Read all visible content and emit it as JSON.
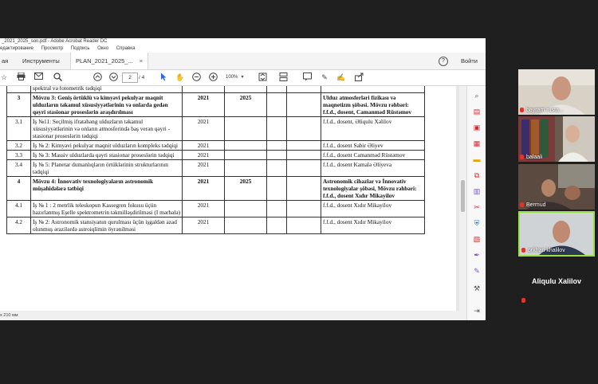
{
  "window": {
    "title": "_2021_2025_son.pdf - Adobe Acrobat Reader DC",
    "menu": [
      "едактирование",
      "Просмотр",
      "Подпись",
      "Окно",
      "Справка"
    ]
  },
  "tabs": {
    "home": "ая",
    "tools": "Инструменты",
    "doc": "PLAN_2021_2025_...",
    "close": "×",
    "signin": "Войти",
    "help": "?"
  },
  "toolbar": {
    "page_current": "2",
    "page_total": "/ 4",
    "zoom": "100%"
  },
  "status": {
    "size": "x 210 мм"
  },
  "table": [
    {
      "id": "",
      "text": "spektral və fotometrik tədqiqi",
      "start": "",
      "end": "",
      "resp": "",
      "bold": false
    },
    {
      "id": "3",
      "text": "Mövzu 3: Geniş örtüklü və kimyəvi pekulyar maqnit ulduzların təkamul xüsusiyyətlərinin və onlarda gedən qəyri stasionar proseslərin araşdırılması",
      "start": "2021",
      "end": "2025",
      "resp": "Ulduz atmosferləri fizikası və maqnetizm şöbəsi. Mövzu rəhbəri: f.f.d., dosent, Camanməd Rüstəmov",
      "bold": true
    },
    {
      "id": "3.1",
      "text": "İş №11: Seçilmiş ifratəhəng ulduzların təkamul xüsusiyyətlərinin və onların atmosferində baş verən qəyri -stasionar proseslərin tədqiqi",
      "start": "2021",
      "end": "",
      "resp": "f.f.d., dosent, Əliqulu Xəlilov",
      "bold": false
    },
    {
      "id": "3.2",
      "text": "İş № 2: Kimyəvi pekulyar maqnit ulduzların kompleks tədqiqi",
      "start": "2021",
      "end": "",
      "resp": "f.f.d., dosent Sabir Əliyev",
      "bold": false
    },
    {
      "id": "3.3",
      "text": "İş № 3: Massiv ulduzlarda qəyri stasionar proseslərin tədqiqi",
      "start": "2021",
      "end": "",
      "resp": "f.f.d., dosent Camanməd Rüstəmov",
      "bold": false
    },
    {
      "id": "3.4",
      "text": "İş № 5: Planetar dumanlıqların örtüklərinin strukturlarının tədqiqi",
      "start": "2021",
      "end": "",
      "resp": "f.f.d., dosent Kamalə Əliyeva",
      "bold": false
    },
    {
      "id": "4",
      "text": "Mövzu 4: İnnovativ texnologiyaların astronomik müşahidələrə tətbiqi",
      "start": "2021",
      "end": "2025",
      "resp": "Astronomik cihazlar və İnnovativ texnologiyalar şöbəsi, Mövzu rəhbəri: f.f.d., dosent Xıdır Mikayilov",
      "bold": true
    },
    {
      "id": "4.1",
      "text": "İş № 1 :   2 metrlik teleskopun Kassegren fokusu üçün hazırlanmış Eşelle spektrometrin təkmilləşdirilməsi (I mərhələ)",
      "start": "2021",
      "end": "",
      "resp": "f.f.d., dosent Xıdır Mikayilov",
      "bold": false
    },
    {
      "id": "4.2",
      "text": "İş № 2:   Astronomik stansiyanın qurulması üçün işgaldən azad olunmuş ərazilərdə astroiqlimin öyrənilməsi",
      "start": "2021",
      "end": "",
      "resp": "f.f.d., dosent Xıdır Mikayilov",
      "bold": false
    }
  ],
  "participants": [
    {
      "name": "bayram rusta...",
      "muted": true
    },
    {
      "name": "balaali",
      "muted": true
    },
    {
      "name": "Bermud",
      "muted": true
    },
    {
      "name": "orkhan khalilov",
      "muted": true
    },
    {
      "name": "Aliqulu Xalilov",
      "muted": true
    }
  ],
  "colors": {
    "speaker_border": "#9be04a",
    "mic_muted": "#e0352b",
    "acrobat_red": "#d7282f"
  },
  "icons": [
    "home-icon",
    "print-icon",
    "mail-icon",
    "search-icon",
    "page-up-icon",
    "page-down-icon",
    "cursor-icon",
    "hand-icon",
    "zoom-out-icon",
    "zoom-in-icon",
    "fit-page-icon",
    "scroll-mode-icon",
    "comment-icon",
    "pen-icon",
    "sign-icon",
    "share-icon"
  ]
}
